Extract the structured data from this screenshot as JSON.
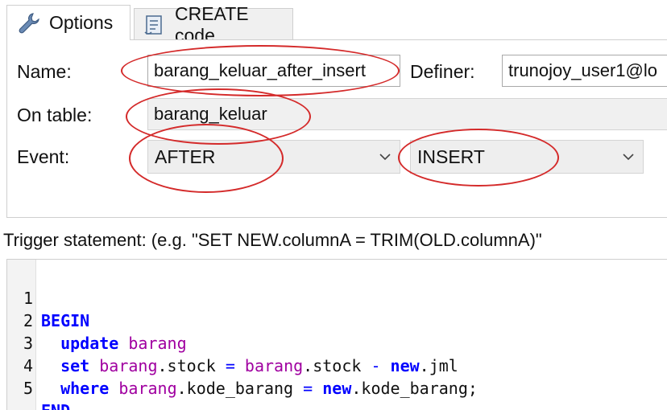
{
  "tabs": [
    {
      "label": "Options",
      "icon": "wrench-icon",
      "active": true
    },
    {
      "label": "CREATE code",
      "icon": "script-icon",
      "active": false
    }
  ],
  "form": {
    "name_label": "Name:",
    "name_value": "barang_keluar_after_insert",
    "definer_label": "Definer:",
    "definer_value": "trunojoy_user1@lo",
    "table_label": "On table:",
    "table_value": "barang_keluar",
    "event_label": "Event:",
    "timing_value": "AFTER",
    "event_value": "INSERT"
  },
  "statement_label": "Trigger statement: (e.g. \"SET NEW.columnA = TRIM(OLD.columnA)\"",
  "code": {
    "line_numbers": [
      "1",
      "2",
      "3",
      "4",
      "5"
    ],
    "l1_kw": "BEGIN",
    "l2_kw": "update",
    "l2_id": "barang",
    "l3_kw": "set",
    "l3_a": "barang",
    "l3_b": ".stock",
    "l3_eq": "=",
    "l3_c": "barang",
    "l3_d": ".stock",
    "l3_minus": "-",
    "l3_e": "new",
    "l3_f": ".jml",
    "l4_kw": "where",
    "l4_a": "barang",
    "l4_b": ".kode_barang",
    "l4_eq": "=",
    "l4_c": "new",
    "l4_d": ".kode_barang;",
    "l5_kw": "END"
  },
  "colors": {
    "keyword": "#0000ff",
    "identifier": "#a000a0",
    "annotation": "#d42a2a"
  }
}
